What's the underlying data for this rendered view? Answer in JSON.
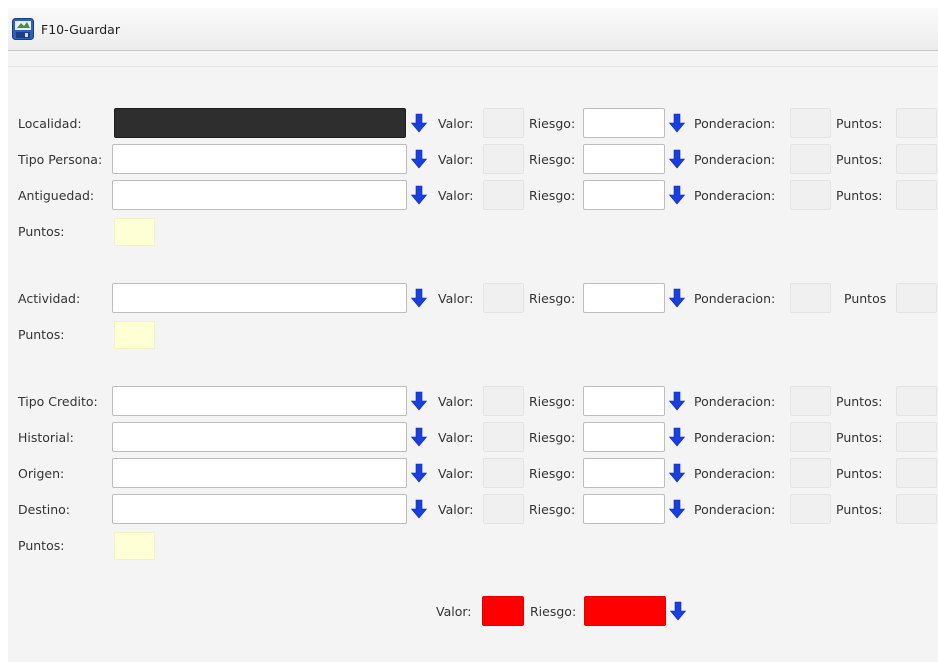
{
  "toolbar": {
    "save_label": "F10-Guardar"
  },
  "labels": {
    "valor": "Valor:",
    "riesgo": "Riesgo:",
    "ponderacion": "Ponderacion:",
    "puntos": "Puntos:",
    "puntos_nocolon": "Puntos"
  },
  "section1": {
    "rows": [
      {
        "label": "Localidad:"
      },
      {
        "label": "Tipo Persona:"
      },
      {
        "label": "Antiguedad:"
      }
    ],
    "subtotal_label": "Puntos:"
  },
  "section2": {
    "rows": [
      {
        "label": "Actividad:"
      }
    ],
    "subtotal_label": "Puntos:"
  },
  "section3": {
    "rows": [
      {
        "label": "Tipo Credito:"
      },
      {
        "label": "Historial:"
      },
      {
        "label": "Origen:"
      },
      {
        "label": "Destino:"
      }
    ],
    "subtotal_label": "Puntos:"
  },
  "summary": {
    "valor_label": "Valor:",
    "riesgo_label": "Riesgo:"
  },
  "colors": {
    "accent_arrow": "#1a3fe0",
    "filled_combo": "#2e2e2e",
    "risk_red": "#ff0000",
    "points_yellow": "#ffffd6"
  },
  "icons": {
    "save": "save-icon",
    "dropdown": "arrow-down-icon"
  }
}
